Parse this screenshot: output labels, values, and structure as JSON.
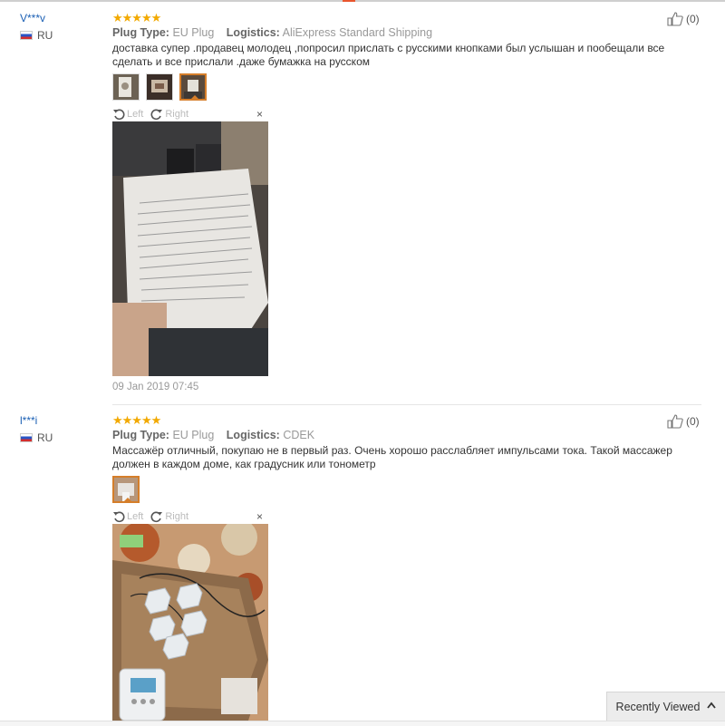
{
  "reviews": [
    {
      "user": "V***v",
      "country": "RU",
      "stars": "★★★★★",
      "plug_label": "Plug Type:",
      "plug_value": "EU Plug",
      "logistics_label": "Logistics:",
      "logistics_value": "AliExpress Standard Shipping",
      "text": "доставка супер .продавец молодец ,попросил прислать с русскими кнопками был услышан и пообещали все сделать и все прислали .даже бумажка на русском",
      "likes": "(0)",
      "left_label": "Left",
      "right_label": "Right",
      "close_label": "×",
      "date": "09 Jan 2019 07:45"
    },
    {
      "user": "l***i",
      "country": "RU",
      "stars": "★★★★★",
      "plug_label": "Plug Type:",
      "plug_value": "EU Plug",
      "logistics_label": "Logistics:",
      "logistics_value": "CDEK",
      "text": "Массажёр отличный, покупаю не в первый раз. Очень хорошо расслабляет импульсами тока. Такой массажер должен в каждом доме, как градусник или тонометр",
      "likes": "(0)",
      "left_label": "Left",
      "right_label": "Right",
      "close_label": "×"
    }
  ],
  "recently_viewed": "Recently Viewed",
  "colors": {
    "accent": "#e8552d",
    "star": "#f2a900",
    "link": "#1a5fb4"
  }
}
